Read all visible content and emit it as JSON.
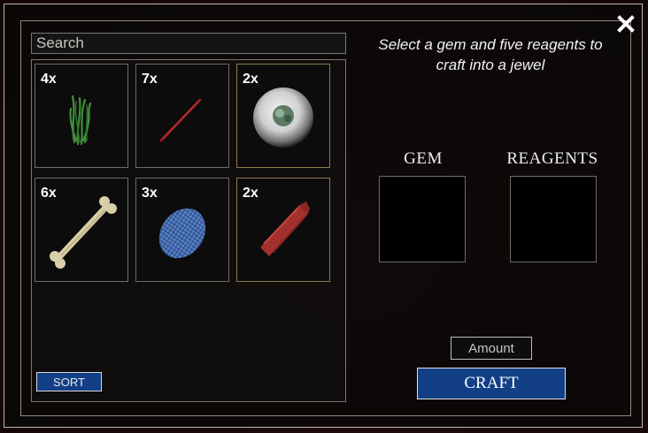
{
  "search": {
    "placeholder": "Search"
  },
  "inventory": {
    "items": [
      {
        "name": "grass",
        "count": "4x",
        "icon": "grass-icon"
      },
      {
        "name": "red-needle",
        "count": "7x",
        "icon": "red-needle-icon"
      },
      {
        "name": "orb",
        "count": "2x",
        "icon": "orb-icon"
      },
      {
        "name": "bone",
        "count": "6x",
        "icon": "bone-icon"
      },
      {
        "name": "blue-scale",
        "count": "3x",
        "icon": "blue-scale-icon"
      },
      {
        "name": "red-cloth",
        "count": "2x",
        "icon": "red-cloth-icon"
      }
    ],
    "sort_label": "SORT"
  },
  "crafting": {
    "instructions": "Select a gem and five reagents to craft into a jewel",
    "gem_label": "GEM",
    "reagents_label": "REAGENTS",
    "amount_placeholder": "Amount",
    "craft_label": "CRAFT"
  },
  "colors": {
    "button_blue": "#123f86",
    "slot_border_gold": "#8b7b4a"
  }
}
